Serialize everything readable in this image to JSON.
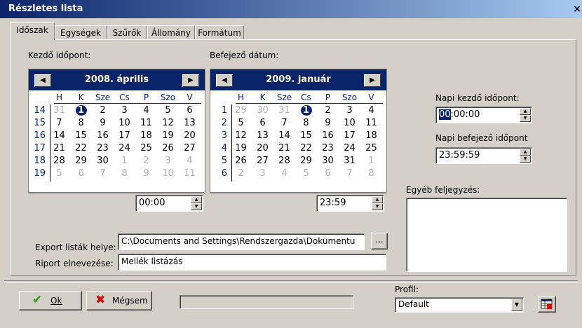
{
  "window": {
    "title": "Részletes lista",
    "close": "×"
  },
  "tabs": [
    {
      "label": "Időszak"
    },
    {
      "label": "Egységek"
    },
    {
      "label": "Szűrők"
    },
    {
      "label": "Állomány"
    },
    {
      "label": "Formátum"
    }
  ],
  "start": {
    "label": "Kezdő időpont:",
    "month": "2008. április",
    "time": "00:00",
    "day_headers": [
      "H",
      "K",
      "Sze",
      "Cs",
      "P",
      "Szo",
      "V"
    ],
    "weeks": [
      "14",
      "15",
      "16",
      "17",
      "18",
      "19"
    ],
    "days": [
      [
        "31",
        "1",
        "2",
        "3",
        "4",
        "5",
        "6"
      ],
      [
        "7",
        "8",
        "9",
        "10",
        "11",
        "12",
        "13"
      ],
      [
        "14",
        "15",
        "16",
        "17",
        "18",
        "19",
        "20"
      ],
      [
        "21",
        "22",
        "23",
        "24",
        "25",
        "26",
        "27"
      ],
      [
        "28",
        "29",
        "30",
        "1",
        "2",
        "3",
        "4"
      ],
      [
        "5",
        "6",
        "7",
        "8",
        "9",
        "10",
        "11"
      ]
    ]
  },
  "end": {
    "label": "Befejező dátum:",
    "month": "2009. január",
    "time": "23:59",
    "day_headers": [
      "H",
      "K",
      "Sze",
      "Cs",
      "P",
      "Szo",
      "V"
    ],
    "weeks": [
      "1",
      "2",
      "3",
      "4",
      "5",
      "6"
    ],
    "days": [
      [
        "29",
        "30",
        "31",
        "1",
        "2",
        "3",
        "4"
      ],
      [
        "5",
        "6",
        "7",
        "8",
        "9",
        "10",
        "11"
      ],
      [
        "12",
        "13",
        "14",
        "15",
        "16",
        "17",
        "18"
      ],
      [
        "19",
        "20",
        "21",
        "22",
        "23",
        "24",
        "25"
      ],
      [
        "26",
        "27",
        "28",
        "29",
        "30",
        "31",
        "1"
      ],
      [
        "2",
        "3",
        "4",
        "5",
        "6",
        "7",
        "8"
      ]
    ]
  },
  "nav": {
    "prev": "◀",
    "next": "▶"
  },
  "daily_start": {
    "label": "Napi kezdő időpont:",
    "value_sel": "00",
    "value_rest": ":00:00"
  },
  "daily_end": {
    "label": "Napi befejező időpont",
    "value": "23:59:59"
  },
  "notes": {
    "label": "Egyéb feljegyzés:",
    "value": ""
  },
  "export": {
    "label": "Export listák helye:",
    "value": "C:\\Documents and Settings\\Rendszergazda\\Dokumentu",
    "browse": "..."
  },
  "report": {
    "label": "Riport elnevezése:",
    "value": "Mellék listázás"
  },
  "buttons": {
    "ok": "Ok",
    "cancel": "Mégsem"
  },
  "profile": {
    "label": "Profil:",
    "value": "Default"
  },
  "colors": {
    "selection": "#0a246a",
    "ok_check": "#2e9b1e",
    "cancel_x": "#cc1010"
  }
}
